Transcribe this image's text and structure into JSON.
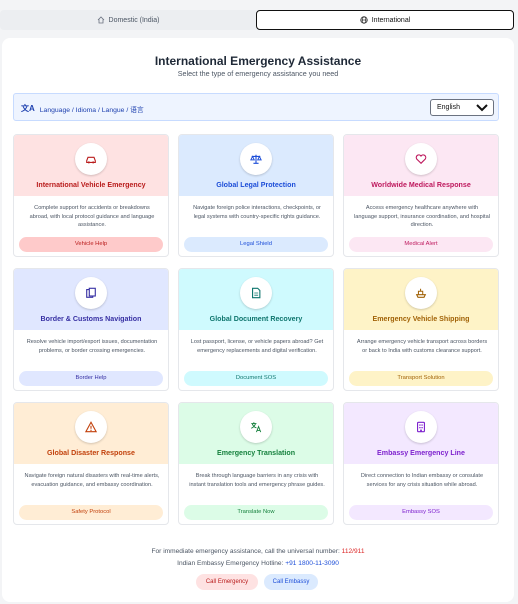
{
  "tabs": [
    {
      "label": "Domestic (India)",
      "icon": "home-icon"
    },
    {
      "label": "International",
      "icon": "globe-icon"
    }
  ],
  "header": {
    "title": "International Emergency Assistance",
    "subtitle": "Select the type of emergency assistance you need"
  },
  "language": {
    "label": "Language / Idioma / Langue / 语言",
    "selected": "English"
  },
  "cards": [
    {
      "title": "International Vehicle Emergency",
      "desc": "Complete support for accidents or breakdowns abroad, with local protocol guidance and language assistance.",
      "button": "Vehicle Help",
      "icon": "car-icon",
      "bg": "#fee2e2",
      "accent": "#b91c1c",
      "btn_bg": "#fecaca"
    },
    {
      "title": "Global Legal Protection",
      "desc": "Navigate foreign police interactions, checkpoints, or legal systems with country-specific rights guidance.",
      "button": "Legal Shield",
      "icon": "scale-icon",
      "bg": "#dbeafe",
      "accent": "#1d4ed8",
      "btn_bg": "#dbeafe"
    },
    {
      "title": "Worldwide Medical Response",
      "desc": "Access emergency healthcare anywhere with language support, insurance coordination, and hospital direction.",
      "button": "Medical Alert",
      "icon": "heart-icon",
      "bg": "#fce7f3",
      "accent": "#be185d",
      "btn_bg": "#fce7f3"
    },
    {
      "title": "Border & Customs Navigation",
      "desc": "Resolve vehicle import/export issues, documentation problems, or border crossing emergencies.",
      "button": "Border Help",
      "icon": "documents-icon",
      "bg": "#e0e7ff",
      "accent": "#3730a3",
      "btn_bg": "#e0e7ff"
    },
    {
      "title": "Global Document Recovery",
      "desc": "Lost passport, license, or vehicle papers abroad? Get emergency replacements and digital verification.",
      "button": "Document SOS",
      "icon": "file-icon",
      "bg": "#cffafe",
      "accent": "#0f766e",
      "btn_bg": "#cffafe"
    },
    {
      "title": "Emergency Vehicle Shipping",
      "desc": "Arrange emergency vehicle transport across borders or back to India with customs clearance support.",
      "button": "Transport Solution",
      "icon": "ship-icon",
      "bg": "#fef3c7",
      "accent": "#a16207",
      "btn_bg": "#fef3c7"
    },
    {
      "title": "Global Disaster Response",
      "desc": "Navigate foreign natural disasters with real-time alerts, evacuation guidance, and embassy coordination.",
      "button": "Safety Protocol",
      "icon": "warning-icon",
      "bg": "#ffedd5",
      "accent": "#c2410c",
      "btn_bg": "#ffedd5"
    },
    {
      "title": "Emergency Translation",
      "desc": "Break through language barriers in any crisis with instant translation tools and emergency phrase guides.",
      "button": "Translate Now",
      "icon": "translate-icon",
      "bg": "#dcfce7",
      "accent": "#15803d",
      "btn_bg": "#dcfce7"
    },
    {
      "title": "Embassy Emergency Line",
      "desc": "Direct connection to Indian embassy or consulate services for any crisis situation while abroad.",
      "button": "Embassy SOS",
      "icon": "building-icon",
      "bg": "#f3e8ff",
      "accent": "#7e22ce",
      "btn_bg": "#f3e8ff"
    }
  ],
  "footer": {
    "line1_prefix": "For immediate emergency assistance, call the universal number: ",
    "line1_number": "112/911",
    "line2_prefix": "Indian Embassy Emergency Hotline: ",
    "line2_number": "+91 1800-11-3090",
    "call_emergency": "Call Emergency",
    "call_embassy": "Call Embassy"
  }
}
